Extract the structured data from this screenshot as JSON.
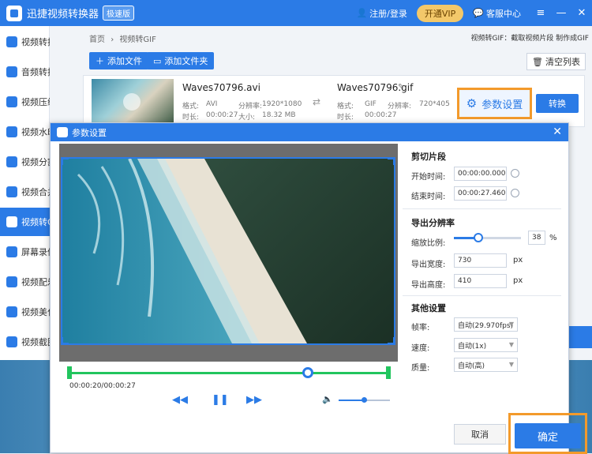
{
  "app": {
    "title": "迅捷视频转换器",
    "edition": "极速版",
    "register_login": "注册/登录",
    "vip": "开通VIP",
    "support": "客服中心"
  },
  "sidebar": {
    "items": [
      {
        "label": "视频转换",
        "active": false
      },
      {
        "label": "音频转换",
        "active": false
      },
      {
        "label": "视频压缩",
        "active": false
      },
      {
        "label": "视频水印",
        "active": false
      },
      {
        "label": "视频分割",
        "active": false
      },
      {
        "label": "视频合并",
        "active": false
      },
      {
        "label": "视频转GIF",
        "active": true
      },
      {
        "label": "屏幕录像",
        "active": false
      },
      {
        "label": "视频配乐",
        "active": false
      },
      {
        "label": "视频美化",
        "active": false
      },
      {
        "label": "视频截图",
        "active": false
      }
    ]
  },
  "main": {
    "breadcrumb": [
      "首页",
      "›",
      "视频转GIF"
    ],
    "hint": "视频转GIF：截取视频片段 制作成GIF",
    "add_file": "添加文件",
    "add_folder": "添加文件夹",
    "clear_list": "清空列表",
    "file": {
      "src_name": "Waves70796.avi",
      "src_format_label": "格式:",
      "src_format": "AVI",
      "src_res_label": "分辨率:",
      "src_res": "1920*1080",
      "src_dur_label": "时长:",
      "src_dur": "00:00:27",
      "src_size_label": "大小:",
      "src_size": "18.32 MB",
      "dst_name": "Waves70796.gif",
      "dst_format_label": "格式:",
      "dst_format": "GIF",
      "dst_res_label": "分辨率:",
      "dst_res": "720*405",
      "dst_dur_label": "时长:",
      "dst_dur": "00:00:27",
      "param_button": "参数设置",
      "convert_button": "转换"
    }
  },
  "dialog": {
    "title": "参数设置",
    "player": {
      "time": "00:00:20/00:00:27",
      "progress": 0.74,
      "volume": 0.5
    },
    "clip": {
      "title": "剪切片段",
      "start_label": "开始时间:",
      "start": "00:00:00.000",
      "end_label": "结束时间:",
      "end": "00:00:27.460"
    },
    "resolution": {
      "title": "导出分辨率",
      "scale_label": "缩放比例:",
      "scale": "38",
      "scale_unit": "%",
      "width_label": "导出宽度:",
      "width": "730",
      "width_unit": "px",
      "height_label": "导出高度:",
      "height": "410",
      "height_unit": "px"
    },
    "other": {
      "title": "其他设置",
      "fps_label": "帧率:",
      "fps": "自动(29.970fps)",
      "speed_label": "速度:",
      "speed": "自动(1x)",
      "quality_label": "质量:",
      "quality": "自动(高)"
    },
    "cancel": "取消",
    "ok": "确定"
  },
  "colors": {
    "accent": "#2b7be6",
    "highlight": "#f39a2b",
    "timeline": "#22c55e"
  }
}
